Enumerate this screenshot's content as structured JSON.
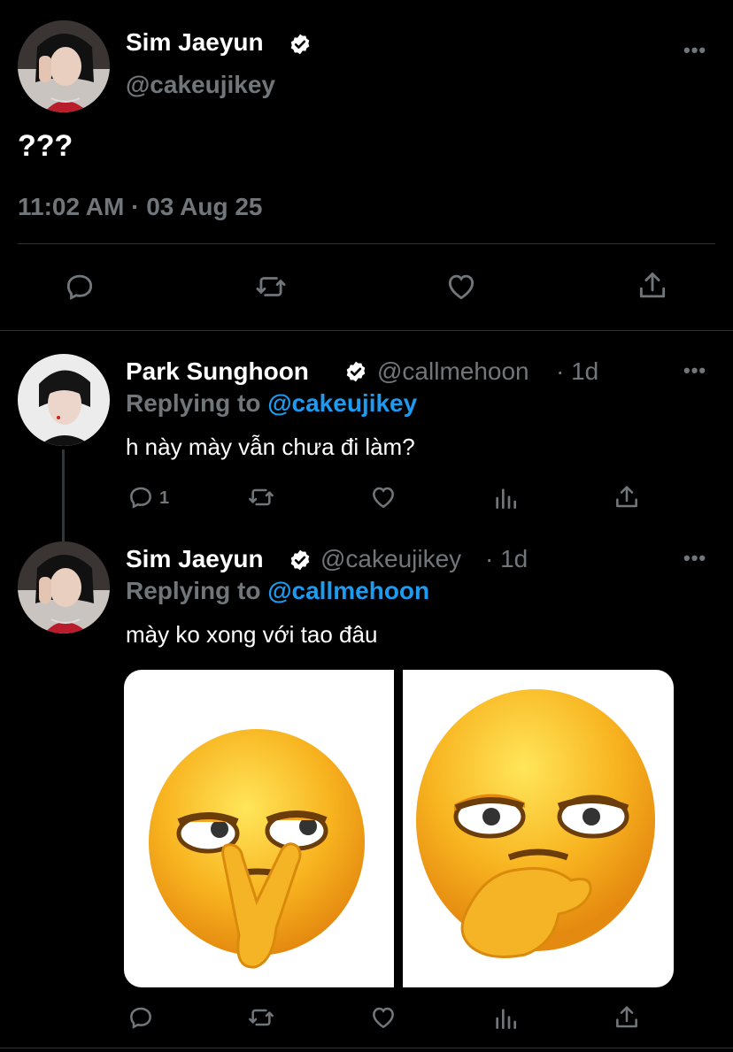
{
  "main_tweet": {
    "name": "Sim Jaeyun",
    "handle": "@cakeujikey",
    "text": "???",
    "timestamp": "11:02 AM · 03 Aug 25",
    "more": "•••"
  },
  "replies": [
    {
      "name": "Park Sunghoon",
      "handle": "@callmehoon",
      "age": "· 1d",
      "replying_label": "Replying to",
      "replying_to": "@cakeujikey",
      "text": "h này mày vẫn chưa đi làm?",
      "reply_count": "1",
      "more": "•••"
    },
    {
      "name": "Sim Jaeyun",
      "handle": "@cakeujikey",
      "age": "· 1d",
      "replying_label": "Replying to",
      "replying_to": "@callmehoon",
      "text": "mày ko xong với tao đâu",
      "more": "•••"
    }
  ],
  "colors": {
    "background": "#000000",
    "muted": "#71767b",
    "link": "#1d9bf0",
    "divider": "#2f3336",
    "emoji_yellow": "#f7b522"
  }
}
